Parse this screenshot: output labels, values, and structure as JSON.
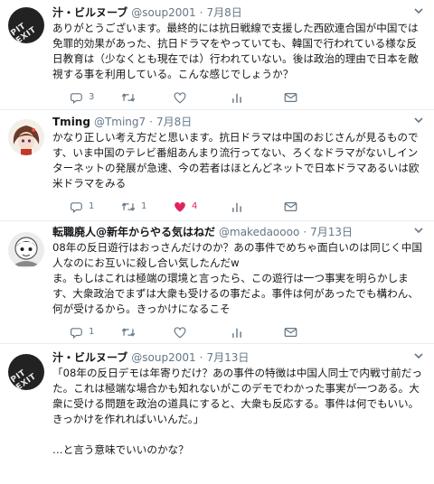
{
  "tweets": [
    {
      "name": "汁・ビルヌーブ",
      "handle": "@soup2001",
      "date": "7月8日",
      "avatar_text": "PIT EXIT",
      "lines": [
        "ありがとうございます。最終的には抗日戦線で支援した西欧連合国が中国では",
        "免罪的効果があった、抗日ドラマをやっていても、韓国で行われている様な反",
        "日教育は（少なくとも現在では）行われていない。後は政治的理由で日本を敵",
        "視する事を利用している。こんな感じでしょうか？"
      ],
      "reply_count": "3",
      "retweet_count": "",
      "like_count": "",
      "liked": false
    },
    {
      "name": "Tming",
      "handle": "@Tming7",
      "date": "7月8日",
      "avatar_text": "",
      "lines": [
        "かなり正しい考え方だと思います。抗日ドラマは中国のおじさんが見るもので",
        "す、いま中国のテレビ番組あんまり流行ってない、ろくなドラマがないしイン",
        "ターネットの発展が急速、今の若者はほとんどネットで日本ドラマあるいは欧",
        "米ドラマをみる"
      ],
      "reply_count": "1",
      "retweet_count": "1",
      "like_count": "4",
      "liked": true
    },
    {
      "name": "転職廃人@新年からやる気はねだ",
      "handle": "@makedaoooo",
      "date": "7月13日",
      "avatar_text": "",
      "lines": [
        "08年の反日遊行はおっさんだけのか？あの事件でめちゃ面白いのは同じく中国",
        "人なのにお互いに殺し合い気したんだw",
        "ま。もしはこれは極端の環境と言ったら、この遊行は一つ事実を明らかしま",
        "す、大衆政治でまずは大衆も受けるの事だよ。事件は何があったでも構わん、",
        "何が受けるから。きっかけになるこそ"
      ],
      "reply_count": "1",
      "retweet_count": "",
      "like_count": "",
      "liked": false
    },
    {
      "name": "汁・ビルヌーブ",
      "handle": "@soup2001",
      "date": "7月13日",
      "avatar_text": "PIT EXIT",
      "lines": [
        "「08年の反日デモは年寄りだけ？あの事件の特徴は中国人同士で内戦寸前だっ",
        "た。これは極端な場合かも知れないがこのデモでわかった事実が一つある。大",
        "衆に受ける問題を政治の道具にすると、大衆も反応する。事件は何でもいい。",
        "きっかけを作れればいいんだ。」",
        "",
        "…と言う意味でいいのかな？"
      ],
      "reply_count": "",
      "retweet_count": "",
      "like_count": "",
      "liked": false
    }
  ],
  "colors": {
    "text": "#14171a",
    "muted": "#657786",
    "like_red": "#e0245e",
    "separator": "#e6ecf0"
  },
  "icons": [
    "reply-icon",
    "retweet-icon",
    "heart-icon",
    "analytics-icon",
    "dm-icon",
    "chevron-down-icon"
  ]
}
